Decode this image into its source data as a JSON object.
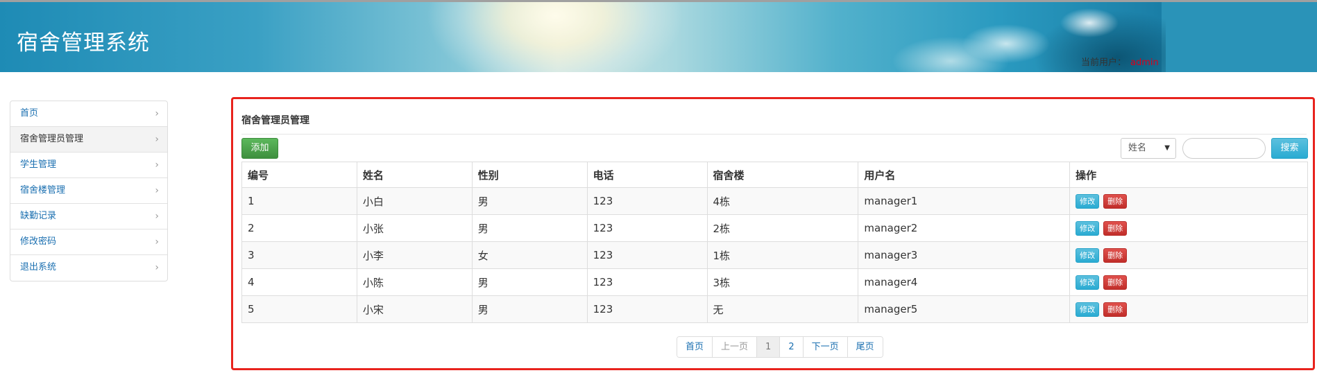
{
  "header": {
    "title": "宿舍管理系统",
    "current_user_label": "当前用户：",
    "current_user": "admin",
    "user_color": "#d9001b"
  },
  "sidebar": {
    "items": [
      {
        "label": "首页",
        "active": false
      },
      {
        "label": "宿舍管理员管理",
        "active": true
      },
      {
        "label": "学生管理",
        "active": false
      },
      {
        "label": "宿舍楼管理",
        "active": false
      },
      {
        "label": "缺勤记录",
        "active": false
      },
      {
        "label": "修改密码",
        "active": false
      },
      {
        "label": "退出系统",
        "active": false
      }
    ],
    "chevron_icon": "chevron-right-icon"
  },
  "main": {
    "title": "宿舍管理员管理",
    "add_label": "添加",
    "search_field": {
      "selected": "姓名",
      "value": ""
    },
    "search_label": "搜索",
    "columns": [
      "编号",
      "姓名",
      "性别",
      "电话",
      "宿舍楼",
      "用户名",
      "操作"
    ],
    "rows": [
      {
        "id": "1",
        "name": "小白",
        "gender": "男",
        "phone": "123",
        "building": "4栋",
        "username": "manager1"
      },
      {
        "id": "2",
        "name": "小张",
        "gender": "男",
        "phone": "123",
        "building": "2栋",
        "username": "manager2"
      },
      {
        "id": "3",
        "name": "小李",
        "gender": "女",
        "phone": "123",
        "building": "1栋",
        "username": "manager3"
      },
      {
        "id": "4",
        "name": "小陈",
        "gender": "男",
        "phone": "123",
        "building": "3栋",
        "username": "manager4"
      },
      {
        "id": "5",
        "name": "小宋",
        "gender": "男",
        "phone": "123",
        "building": "无",
        "username": "manager5"
      }
    ],
    "row_actions": {
      "edit": "修改",
      "delete": "删除"
    },
    "pagination": {
      "first": "首页",
      "prev": "上一页",
      "pages": [
        "1",
        "2"
      ],
      "current_page": "1",
      "next": "下一页",
      "last": "尾页"
    },
    "highlight_color": "#e8231d"
  }
}
